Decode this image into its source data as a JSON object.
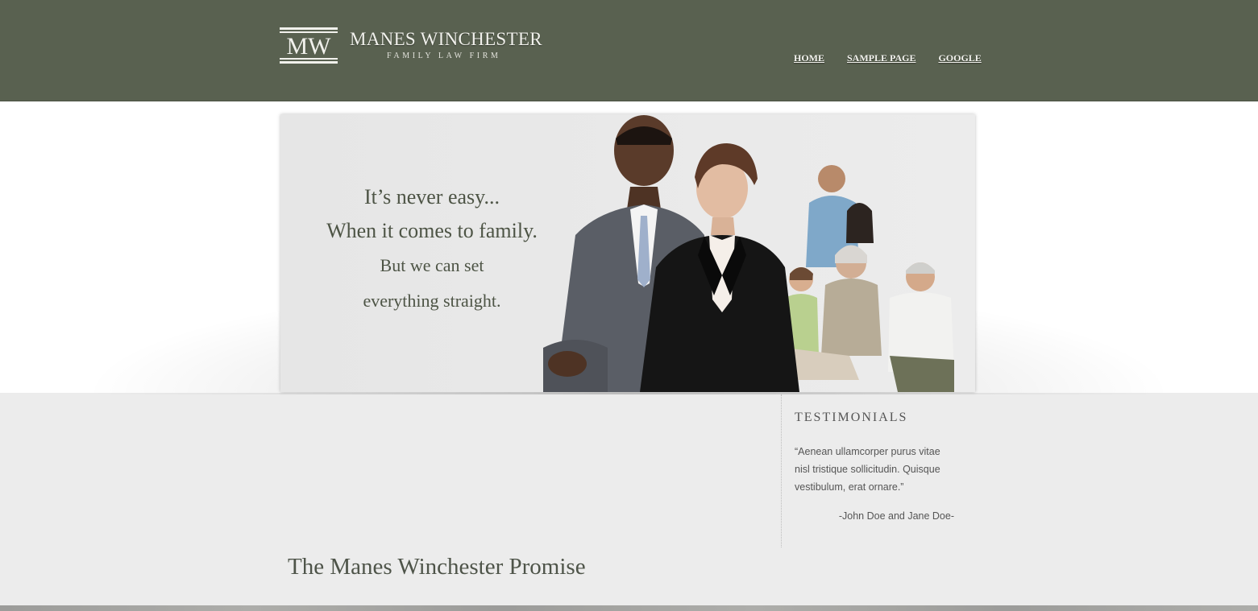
{
  "brand": {
    "monogram": "MW",
    "name": "MANES WINCHESTER",
    "tagline": "FAMILY LAW FIRM"
  },
  "nav": {
    "items": [
      "HOME",
      "SAMPLE PAGE",
      "GOOGLE"
    ]
  },
  "hero": {
    "line1": "It’s never easy...",
    "line2": "When it comes to family.",
    "line3": "But we can set",
    "line4": "everything straight."
  },
  "testimonials": {
    "heading": "TESTIMONIALS",
    "quote": "“Aenean ullamcorper purus vitae nisl tristique sollicitudin. Quisque vestibulum, erat ornare.”",
    "author": "-John Doe and Jane Doe-"
  },
  "main": {
    "promise_heading": "The Manes Winchester Promise"
  },
  "colors": {
    "header_bg": "#596150",
    "content_bg": "#ececec",
    "hero_text": "#4d5445"
  }
}
